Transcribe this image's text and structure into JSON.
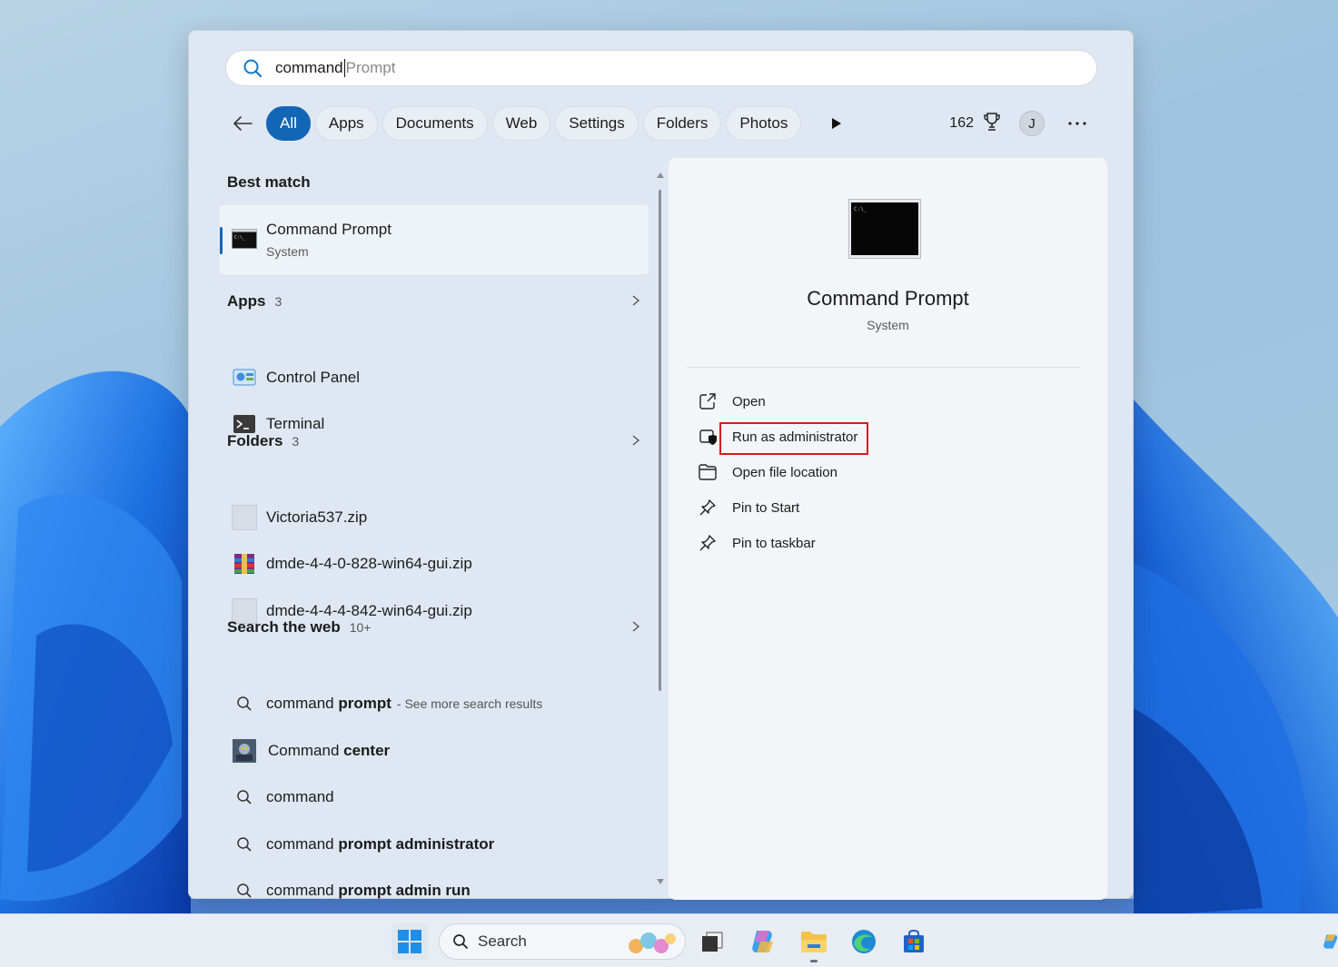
{
  "search": {
    "typed": "command",
    "hint": " Prompt"
  },
  "filters": {
    "tabs": [
      "All",
      "Apps",
      "Documents",
      "Web",
      "Settings",
      "Folders",
      "Photos"
    ],
    "active": "All",
    "points": "162",
    "avatar_initial": "J"
  },
  "best_match": {
    "heading": "Best match",
    "name": "Command Prompt",
    "type": "System"
  },
  "apps": {
    "heading": "Apps",
    "count": "3",
    "items": [
      "Control Panel",
      "Terminal"
    ]
  },
  "folders": {
    "heading": "Folders",
    "count": "3",
    "items": [
      "Victoria537.zip",
      "dmde-4-4-0-828-win64-gui.zip",
      "dmde-4-4-4-842-win64-gui.zip"
    ]
  },
  "web": {
    "heading": "Search the web",
    "count": "10+",
    "items": [
      {
        "plain": "command ",
        "bold": "prompt",
        "suffix": "- See more search results"
      },
      {
        "plain": "Command ",
        "bold": "center",
        "suffix": ""
      },
      {
        "plain": "command",
        "bold": "",
        "suffix": ""
      },
      {
        "plain": "command ",
        "bold": "prompt administrator",
        "suffix": ""
      },
      {
        "plain": "command ",
        "bold": "prompt admin run",
        "suffix": ""
      }
    ]
  },
  "detail": {
    "title": "Command Prompt",
    "subtitle": "System",
    "actions": [
      "Open",
      "Run as administrator",
      "Open file location",
      "Pin to Start",
      "Pin to taskbar"
    ],
    "highlighted_action": "Run as administrator",
    "highlight_color": "#d51b1b"
  },
  "taskbar": {
    "search_label": "Search"
  },
  "colors": {
    "accent": "#1366b5"
  }
}
